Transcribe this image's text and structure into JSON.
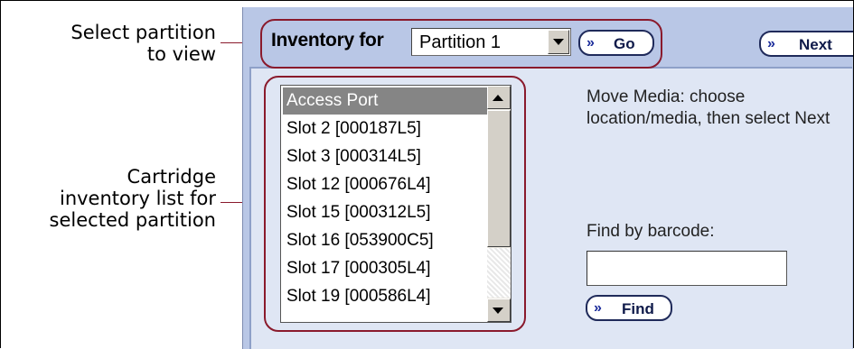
{
  "callouts": {
    "partition": [
      "Select partition",
      "to view"
    ],
    "inventory": [
      "Cartridge",
      "inventory list for",
      "selected partition"
    ]
  },
  "toolbar": {
    "title": "Inventory for",
    "partition_value": "Partition 1",
    "go_label": "Go",
    "next_label": "Next",
    "button_chevron": "»"
  },
  "inventory_list": {
    "items": [
      "Access Port",
      "Slot 2 [000187L5]",
      "Slot 3 [000314L5]",
      "Slot 12 [000676L4]",
      "Slot 15 [000312L5]",
      "Slot 16 [053900C5]",
      "Slot 17 [000305L4]",
      "Slot 19 [000586L4]"
    ],
    "selected_index": 0
  },
  "instructions": "Move Media: choose location/media, then select Next",
  "find": {
    "label": "Find by barcode:",
    "value": "",
    "button_label": "Find"
  },
  "colors": {
    "highlight": "#8a1a2c",
    "panel": "#b9c7e6",
    "panel_inner": "#dfe6f4",
    "selection": "#858585",
    "button_text": "#0f1a4a"
  }
}
